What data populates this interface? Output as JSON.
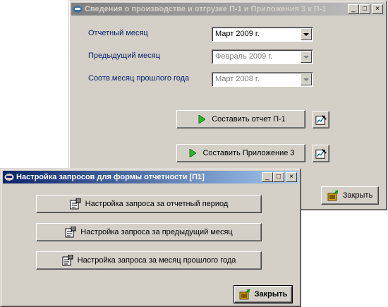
{
  "back_window": {
    "title": "Сведения о производстве и отгрузке П-1 и Приложения 3 к П-1",
    "title_buttons": {
      "minimize": "_",
      "maximize": "□",
      "close": "×"
    },
    "fields": [
      {
        "label": "Отчетный месяц",
        "value": "Март 2009 г.",
        "enabled": true
      },
      {
        "label": "Предыдущий месяц",
        "value": "Февраль 2009 г.",
        "enabled": false
      },
      {
        "label": "Соотв.месяц прошлого года",
        "value": "Март 2008 г.",
        "enabled": false
      }
    ],
    "buttons": {
      "report_p1": "Составить отчет П-1",
      "appendix3": "Составить Приложение 3",
      "close": "Закрыть"
    }
  },
  "front_window": {
    "title": "Настройка запросов для формы отчетности [П1]",
    "title_buttons": {
      "minimize": "_",
      "maximize": "□",
      "close": "×"
    },
    "buttons": [
      "Настройка запроса за отчетный период",
      "Настройка запроса за предыдущий месяц",
      "Настройка запроса за месяц прошлого года"
    ],
    "close": "Закрыть"
  },
  "icons": {
    "app": "app-icon",
    "play": "play-arrow-icon",
    "edit": "edit-chart-icon",
    "settings": "settings-form-icon",
    "close": "exit-door-icon"
  },
  "colors": {
    "label_text": "#0a246a",
    "active_title_start": "#0a246a",
    "active_title_end": "#a6caf0",
    "inactive_title": "#808080",
    "face": "#d4d0c8"
  }
}
